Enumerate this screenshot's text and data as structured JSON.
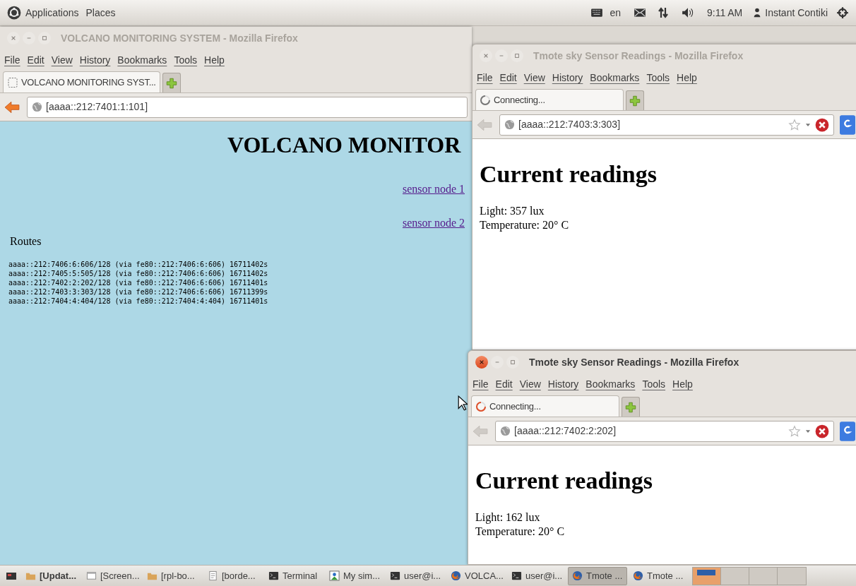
{
  "top_panel": {
    "menus": [
      "Applications",
      "Places"
    ],
    "language": "en",
    "clock": "9:11 AM",
    "user": "Instant Contiki"
  },
  "windows": [
    {
      "title": "VOLCANO MONITORING SYSTEM - Mozilla Firefox",
      "focused": false,
      "menu": [
        "File",
        "Edit",
        "View",
        "History",
        "Bookmarks",
        "Tools",
        "Help"
      ],
      "tab": {
        "label": "VOLCANO MONITORING SYST...",
        "loading": false
      },
      "url": "[aaaa::212:7401:1:101]",
      "back_enabled": true,
      "page": {
        "kind": "monitor",
        "heading": "VOLCANO MONITOR",
        "links": [
          "sensor node 1",
          "sensor node 2"
        ],
        "routes_title": "Routes",
        "routes": [
          "aaaa::212:7406:6:606/128 (via fe80::212:7406:6:606) 16711402s",
          "aaaa::212:7405:5:505/128 (via fe80::212:7406:6:606) 16711402s",
          "aaaa::212:7402:2:202/128 (via fe80::212:7406:6:606) 16711401s",
          "aaaa::212:7403:3:303/128 (via fe80::212:7406:6:606) 16711399s",
          "aaaa::212:7404:4:404/128 (via fe80::212:7404:4:404) 16711401s"
        ]
      }
    },
    {
      "title": "Tmote sky Sensor Readings - Mozilla Firefox",
      "focused": false,
      "menu": [
        "File",
        "Edit",
        "View",
        "History",
        "Bookmarks",
        "Tools",
        "Help"
      ],
      "tab": {
        "label": "Connecting...",
        "loading": true
      },
      "url": "[aaaa::212:7403:3:303]",
      "back_enabled": false,
      "page": {
        "kind": "readings",
        "heading": "Current readings",
        "lines": [
          "Light: 357 lux",
          "Temperature: 20° C"
        ]
      }
    },
    {
      "title": "Tmote sky Sensor Readings - Mozilla Firefox",
      "focused": true,
      "menu": [
        "File",
        "Edit",
        "View",
        "History",
        "Bookmarks",
        "Tools",
        "Help"
      ],
      "tab": {
        "label": "Connecting...",
        "loading": true
      },
      "url": "[aaaa::212:7402:2:202]",
      "back_enabled": false,
      "page": {
        "kind": "readings",
        "heading": "Current readings",
        "lines": [
          "Light: 162 lux",
          "Temperature: 20° C"
        ]
      }
    }
  ],
  "taskbar": [
    {
      "label": "[Updat...",
      "kind": "folder",
      "attention": true,
      "selected": false
    },
    {
      "label": "[Screen...",
      "kind": "window",
      "attention": false,
      "selected": false
    },
    {
      "label": "[rpl-bo...",
      "kind": "folder",
      "attention": false,
      "selected": false
    },
    {
      "label": "[borde...",
      "kind": "document",
      "attention": false,
      "selected": false
    },
    {
      "label": "Terminal",
      "kind": "terminal",
      "attention": false,
      "selected": false
    },
    {
      "label": "My sim...",
      "kind": "app",
      "attention": false,
      "selected": false
    },
    {
      "label": "user@i...",
      "kind": "terminal",
      "attention": false,
      "selected": false
    },
    {
      "label": "VOLCA...",
      "kind": "firefox",
      "attention": false,
      "selected": false
    },
    {
      "label": "user@i...",
      "kind": "terminal",
      "attention": false,
      "selected": false
    },
    {
      "label": "Tmote ...",
      "kind": "firefox",
      "attention": false,
      "selected": true
    },
    {
      "label": "Tmote ...",
      "kind": "firefox",
      "attention": false,
      "selected": false
    }
  ]
}
